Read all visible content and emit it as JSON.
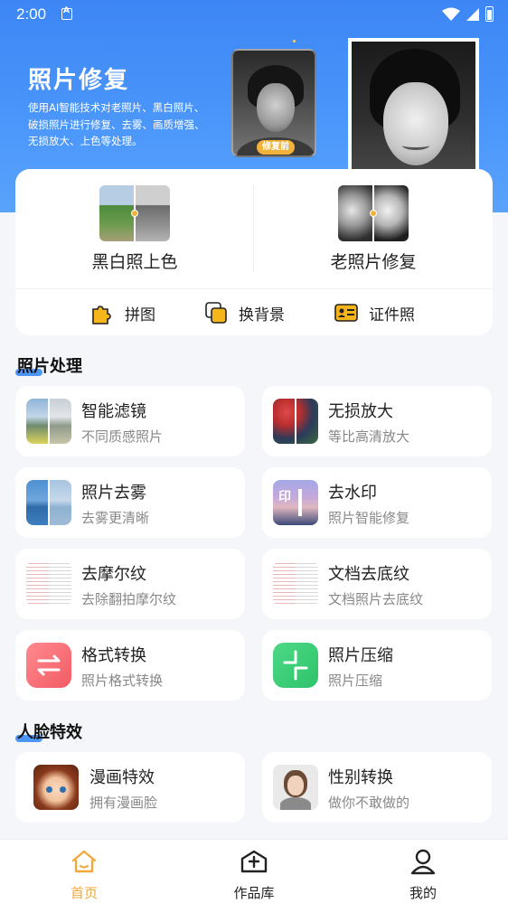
{
  "status_bar": {
    "time": "2:00"
  },
  "hero": {
    "title": "照片修复",
    "description": "使用AI智能技术对老照片、黑白照片、破损照片进行修复、去雾、画质增强、无损放大、上色等处理。",
    "before_badge": "修复前"
  },
  "main_features": [
    {
      "label": "黑白照上色",
      "icon": "colorize-thumbnail"
    },
    {
      "label": "老照片修复",
      "icon": "restore-thumbnail"
    }
  ],
  "quick_tools": [
    {
      "label": "拼图",
      "icon": "puzzle-icon",
      "color": "#f5b51b"
    },
    {
      "label": "换背景",
      "icon": "layers-icon",
      "color": "#f5b51b"
    },
    {
      "label": "证件照",
      "icon": "id-card-icon",
      "color": "#f5b51b"
    }
  ],
  "sections": [
    {
      "title": "照片处理",
      "items": [
        {
          "title": "智能滤镜",
          "subtitle": "不同质感照片"
        },
        {
          "title": "无损放大",
          "subtitle": "等比高清放大"
        },
        {
          "title": "照片去雾",
          "subtitle": "去雾更清晰"
        },
        {
          "title": "去水印",
          "subtitle": "照片智能修复"
        },
        {
          "title": "去摩尔纹",
          "subtitle": "去除翻拍摩尔纹"
        },
        {
          "title": "文档去底纹",
          "subtitle": "文档照片去底纹"
        },
        {
          "title": "格式转换",
          "subtitle": "照片格式转换"
        },
        {
          "title": "照片压缩",
          "subtitle": "照片压缩"
        }
      ]
    },
    {
      "title": "人脸特效",
      "items": [
        {
          "title": "漫画特效",
          "subtitle": "拥有漫画脸"
        },
        {
          "title": "性别转换",
          "subtitle": "做你不敢做的"
        }
      ]
    }
  ],
  "bottom_nav": [
    {
      "label": "首页",
      "active": true
    },
    {
      "label": "作品库",
      "active": false
    },
    {
      "label": "我的",
      "active": false
    }
  ],
  "colors": {
    "hero_blue": "#3d86f5",
    "accent_orange": "#f0a93a",
    "format_red": "#f25b64",
    "compress_green": "#2fc36a"
  }
}
